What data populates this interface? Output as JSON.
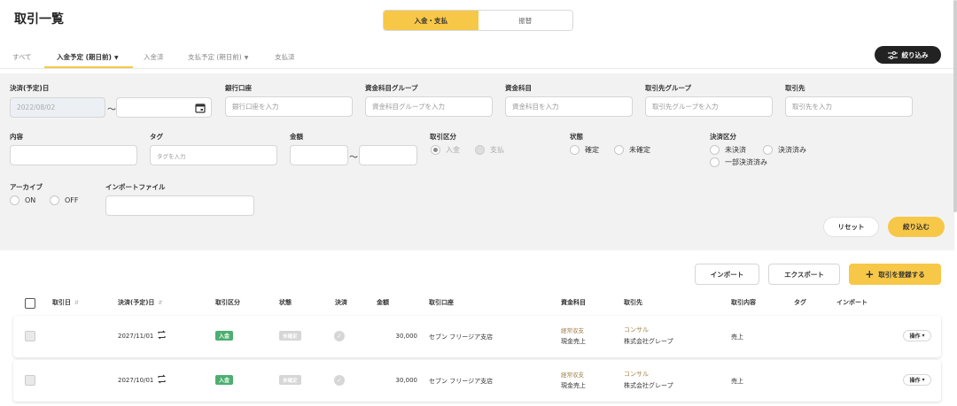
{
  "page": {
    "title": "取引一覧"
  },
  "segment": {
    "items": [
      "入金・支払",
      "振替"
    ],
    "active": 0
  },
  "tabs": {
    "all": "すべて",
    "income_scheduled": "入金予定 (期日前)",
    "income_done": "入金済",
    "payment_scheduled": "支払予定 (期日前)",
    "payment_done": "支払済"
  },
  "filter_toggle": {
    "label": "絞り込み"
  },
  "filters": {
    "settle_date": {
      "label": "決済(予定)日",
      "from": "2022/08/02",
      "to": "",
      "tilde": "〜"
    },
    "bank": {
      "label": "銀行口座",
      "placeholder": "銀行口座を入力"
    },
    "fund_group": {
      "label": "資金科目グループ",
      "placeholder": "資金科目グループを入力"
    },
    "fund": {
      "label": "資金科目",
      "placeholder": "資金科目を入力"
    },
    "partner_group": {
      "label": "取引先グループ",
      "placeholder": "取引先グループを入力"
    },
    "partner": {
      "label": "取引先",
      "placeholder": "取引先を入力"
    },
    "content": {
      "label": "内容",
      "placeholder": ""
    },
    "tag": {
      "label": "タグ",
      "placeholder": "タグを入力"
    },
    "amount": {
      "label": "金額",
      "tilde": "〜"
    },
    "kind": {
      "label": "取引区分",
      "options": [
        "入金",
        "支払"
      ]
    },
    "status": {
      "label": "状態",
      "options": [
        "確定",
        "未確定"
      ]
    },
    "settlement": {
      "label": "決済区分",
      "options": [
        "未決済",
        "決済済み",
        "一部決済済み"
      ]
    },
    "archive": {
      "label": "アーカイブ",
      "options": [
        "ON",
        "OFF"
      ]
    },
    "import_file": {
      "label": "インポートファイル",
      "placeholder": ""
    }
  },
  "buttons": {
    "reset": "リセット",
    "apply": "絞り込む",
    "import": "インポート",
    "export": "エクスポート",
    "add": "取引を登録する"
  },
  "table": {
    "headers": [
      "取引日",
      "決済(予定)日",
      "取引区分",
      "状態",
      "決済",
      "金額",
      "取引口座",
      "資金科目",
      "取引先",
      "取引内容",
      "タグ",
      "インポート"
    ],
    "rows": [
      {
        "trade_date": "",
        "settle_date": "2027/11/01",
        "kind": "入金",
        "status": "未確定",
        "amount": "30,000",
        "account": "セブン フリージア支店",
        "fund_group": "経常収支",
        "fund": "現金売上",
        "partner_group": "コンサル",
        "partner": "株式会社グレープ",
        "content": "売上",
        "tag": "",
        "import": "",
        "op": "操作"
      },
      {
        "trade_date": "",
        "settle_date": "2027/10/01",
        "kind": "入金",
        "status": "未確定",
        "amount": "30,000",
        "account": "セブン フリージア支店",
        "fund_group": "経常収支",
        "fund": "現金売上",
        "partner_group": "コンサル",
        "partner": "株式会社グレープ",
        "content": "売上",
        "tag": "",
        "import": "",
        "op": "操作"
      }
    ]
  },
  "colors": {
    "accent": "#f7c748",
    "dark": "#222222",
    "panel": "#f2f2f2",
    "badge_green": "#4caf70",
    "gold_text": "#a0824a"
  }
}
